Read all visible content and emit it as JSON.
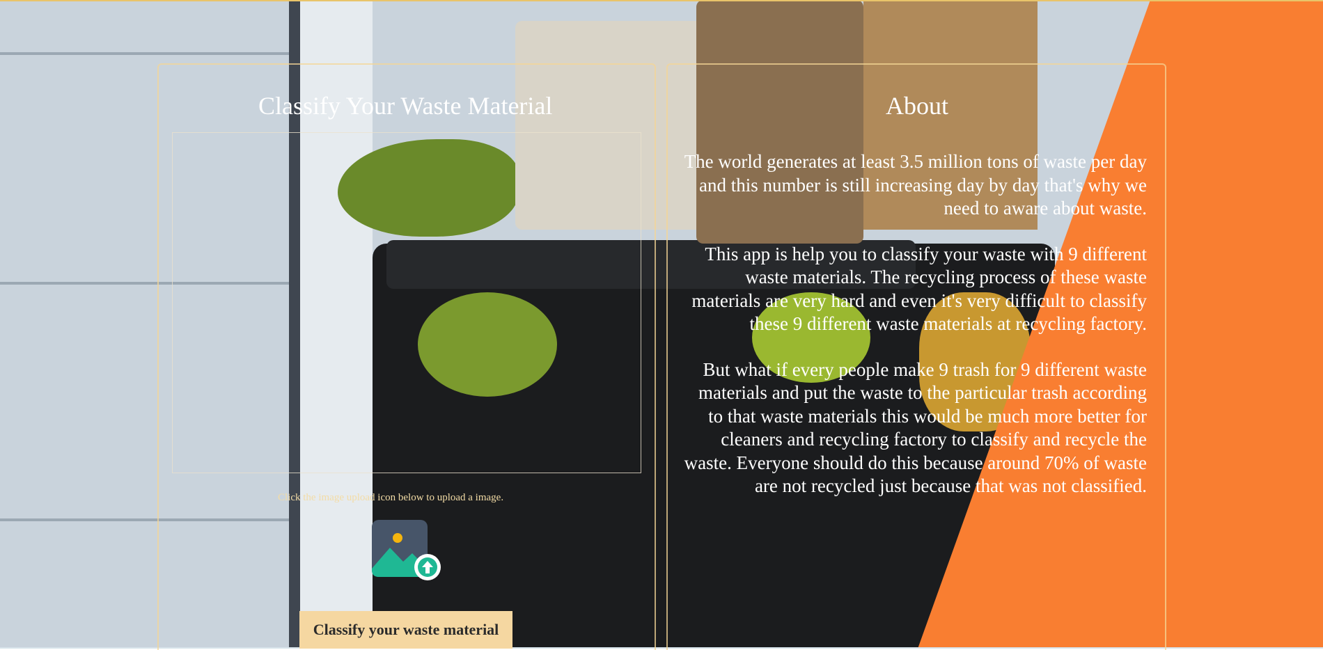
{
  "colors": {
    "accent_orange": "#f97e31",
    "frame_border": "#f5d696",
    "button_bg": "#f5d7a1",
    "hint_text": "#f3dca6",
    "icon_teal": "#1fb894",
    "icon_slate": "#475569",
    "icon_sun": "#f5b50e"
  },
  "classify": {
    "title": "Classify Your Waste Material",
    "upload_hint": "Click the image upload icon below to upload a image.",
    "upload_icon": "image-upload-icon",
    "button_label": "Classify your waste material"
  },
  "about": {
    "title": "About",
    "paragraphs": [
      "The world generates at least 3.5 million tons of waste per day and this number is still increasing day by day that's why we need to aware about waste.",
      "This app is help you to classify your waste with 9 different waste materials. The recycling process of these waste materials are very hard and even it's very difficult to classify these 9 different waste materials at recycling factory.",
      "But what if every people make 9 trash for 9 different waste materials and put the waste to the particular trash according to that waste materials this would be much more better for cleaners and recycling factory to classify and recycle the waste. Everyone should do this because around 70% of waste are not recycled just because that was not classified."
    ]
  }
}
